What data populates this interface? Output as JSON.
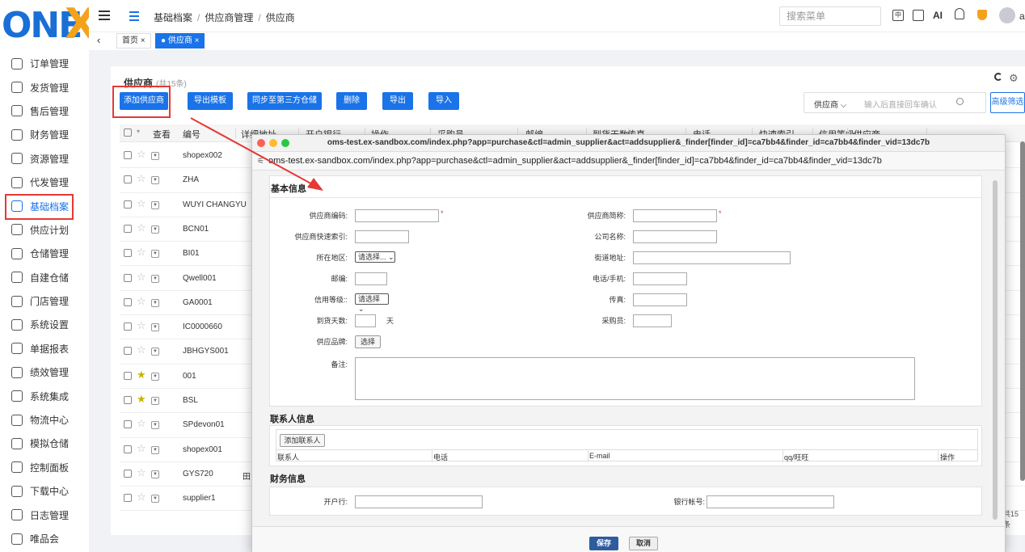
{
  "brand": {
    "logo_text": "ONE",
    "logo_x": "X"
  },
  "sidebar": {
    "items": [
      {
        "label": "订单管理"
      },
      {
        "label": "发货管理"
      },
      {
        "label": "售后管理"
      },
      {
        "label": "财务管理"
      },
      {
        "label": "资源管理"
      },
      {
        "label": "代发管理"
      },
      {
        "label": "基础档案"
      },
      {
        "label": "供应计划"
      },
      {
        "label": "仓储管理"
      },
      {
        "label": "自建仓储"
      },
      {
        "label": "门店管理"
      },
      {
        "label": "系统设置"
      },
      {
        "label": "单据报表"
      },
      {
        "label": "绩效管理"
      },
      {
        "label": "系统集成"
      },
      {
        "label": "物流中心"
      },
      {
        "label": "模拟仓储"
      },
      {
        "label": "控制面板"
      },
      {
        "label": "下载中心"
      },
      {
        "label": "日志管理"
      },
      {
        "label": "唯品会"
      }
    ],
    "active_index": 6
  },
  "header": {
    "breadcrumb": [
      "基础档案",
      "供应商管理",
      "供应商"
    ],
    "search_placeholder": "搜索菜单",
    "icon_zh": "中",
    "ai_label": "AI",
    "user_initial": "a"
  },
  "tabs": [
    {
      "label": "首页 ×",
      "active": false
    },
    {
      "label": "● 供应商 ×",
      "active": true
    }
  ],
  "page": {
    "title": "供应商",
    "count_text": "(共15条)",
    "buttons": [
      "添加供应商",
      "导出模板",
      "同步至第三方仓储",
      "删除",
      "导出",
      "导入"
    ],
    "filter_select": "供应商 ⌵",
    "filter_placeholder": "输入后直接回车确认",
    "advanced_filter": "高级筛选",
    "pager_text": "共15条"
  },
  "table": {
    "headers": [
      "查看",
      "编号",
      "详细地址",
      "开户银行",
      "操作",
      "采购员",
      "邮编",
      "到货天数",
      "传真",
      "电话",
      "快速索引",
      "信用等级",
      "供应商"
    ],
    "rows": [
      {
        "code": "shopex002",
        "starred": false,
        "extra": ""
      },
      {
        "code": "ZHA",
        "starred": false,
        "extra": ""
      },
      {
        "code": "WUYI CHANGYU",
        "starred": false,
        "extra": ""
      },
      {
        "code": "BCN01",
        "starred": false,
        "extra": ""
      },
      {
        "code": "BI01",
        "starred": false,
        "extra": ""
      },
      {
        "code": "Qwell001",
        "starred": false,
        "extra": ""
      },
      {
        "code": "GA0001",
        "starred": false,
        "extra": ""
      },
      {
        "code": "IC0000660",
        "starred": false,
        "extra": ""
      },
      {
        "code": "JBHGYS001",
        "starred": false,
        "extra": ""
      },
      {
        "code": "001",
        "starred": true,
        "extra": ""
      },
      {
        "code": "BSL",
        "starred": true,
        "extra": ""
      },
      {
        "code": "SPdevon01",
        "starred": false,
        "extra": ""
      },
      {
        "code": "shopex001",
        "starred": false,
        "extra": ""
      },
      {
        "code": "GYS720",
        "starred": false,
        "extra": "田"
      },
      {
        "code": "supplier1",
        "starred": false,
        "extra": ""
      }
    ]
  },
  "modal": {
    "window_title": "oms-test.ex-sandbox.com/index.php?app=purchase&ctl=admin_supplier&act=addsupplier&_finder[finder_id]=ca7bb4&finder_id=ca7bb4&finder_vid=13dc7b",
    "url": "oms-test.ex-sandbox.com/index.php?app=purchase&ctl=admin_supplier&act=addsupplier&_finder[finder_id]=ca7bb4&finder_id=ca7bb4&finder_vid=13dc7b",
    "basic_section": "基本信息",
    "fields": {
      "supplier_code": "供应商编码:",
      "supplier_short": "供应商简称:",
      "quick_index": "供应商快速索引:",
      "company_name": "公司名称:",
      "region": "所在地区:",
      "street": "街道地址:",
      "zip": "邮编:",
      "phone": "电话/手机:",
      "credit": "信用等级::",
      "fax": "传真:",
      "arrival_days": "到货天数:",
      "days_unit": "天",
      "purchaser": "采购员:",
      "brand": "供应品牌:",
      "remark": "备注:"
    },
    "region_select": "请选择... ⌄",
    "credit_select": "请选择 ⌄",
    "choose_button": "选择",
    "required_mark": "*",
    "contact_section": "联系人信息",
    "add_contact": "添加联系人",
    "contact_headers": [
      "联系人",
      "电话",
      "E-mail",
      "qq/旺旺",
      "操作"
    ],
    "finance_section": "财务信息",
    "bank_label": "开户行:",
    "account_label": "银行帐号:",
    "save": "保存",
    "cancel": "取消"
  },
  "colors": {
    "primary": "#1a73e8",
    "highlight": "#e53935",
    "logo_blue": "#1a6fd6",
    "logo_orange": "#f5a21b"
  }
}
